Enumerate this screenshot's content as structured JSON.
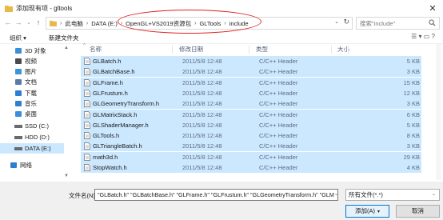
{
  "window": {
    "title": "添加现有项 - gltools",
    "close_glyph": "✕"
  },
  "nav": {
    "back": "←",
    "forward": "→",
    "up_dropdown": "⌄",
    "up": "↑"
  },
  "address": {
    "crumbs": [
      "此电脑",
      "DATA (E:)",
      "OpenGL+VS2019资源包",
      "GLTools",
      "include"
    ],
    "separator": "›",
    "dropdown_glyph": "⌄",
    "refresh_glyph": "↻"
  },
  "search": {
    "placeholder": "搜索\"include\""
  },
  "toolbar": {
    "organize": "组织 ▾",
    "new_folder": "新建文件夹",
    "view_icons": "☰ ▾  ▭  ?"
  },
  "sidebar": {
    "scroll_up": "▲",
    "scroll_down": "▼",
    "items": [
      {
        "label": "3D 对象",
        "icon": "3d-objects-icon",
        "color": "#3b8fd9"
      },
      {
        "label": "视频",
        "icon": "video-icon",
        "color": "#4a4a4a"
      },
      {
        "label": "图片",
        "icon": "pictures-icon",
        "color": "#3a95d8"
      },
      {
        "label": "文档",
        "icon": "documents-icon",
        "color": "#5b7aa8"
      },
      {
        "label": "下载",
        "icon": "downloads-icon",
        "color": "#2f7fd1"
      },
      {
        "label": "音乐",
        "icon": "music-icon",
        "color": "#2f7fd1"
      },
      {
        "label": "桌面",
        "icon": "desktop-icon",
        "color": "#3a8ddc"
      },
      {
        "label": "SSD (C:)",
        "icon": "drive-icon",
        "color": "#6a6a6a"
      },
      {
        "label": "HDD (D:)",
        "icon": "drive-icon",
        "color": "#6a6a6a"
      },
      {
        "label": "DATA (E:)",
        "icon": "drive-icon",
        "color": "#6a6a6a",
        "selected": true
      },
      {
        "label": "网络",
        "icon": "network-icon",
        "color": "#2f7fd1"
      }
    ]
  },
  "columns": {
    "name": "名称",
    "date": "修改日期",
    "type": "类型",
    "size": "大小",
    "sort_glyph": "^"
  },
  "files": [
    {
      "name": "GLBatch.h",
      "date": "2011/5/8 12:48",
      "type": "C/C++ Header",
      "size": "5 KB"
    },
    {
      "name": "GLBatchBase.h",
      "date": "2011/5/8 12:48",
      "type": "C/C++ Header",
      "size": "3 KB"
    },
    {
      "name": "GLFrame.h",
      "date": "2011/5/8 12:48",
      "type": "C/C++ Header",
      "size": "15 KB"
    },
    {
      "name": "GLFrustum.h",
      "date": "2011/5/8 12:48",
      "type": "C/C++ Header",
      "size": "12 KB"
    },
    {
      "name": "GLGeometryTransform.h",
      "date": "2011/5/8 12:48",
      "type": "C/C++ Header",
      "size": "3 KB"
    },
    {
      "name": "GLMatrixStack.h",
      "date": "2011/5/8 12:48",
      "type": "C/C++ Header",
      "size": "6 KB"
    },
    {
      "name": "GLShaderManager.h",
      "date": "2011/5/8 12:48",
      "type": "C/C++ Header",
      "size": "5 KB"
    },
    {
      "name": "GLTools.h",
      "date": "2011/5/8 12:48",
      "type": "C/C++ Header",
      "size": "8 KB"
    },
    {
      "name": "GLTriangleBatch.h",
      "date": "2011/5/8 12:48",
      "type": "C/C++ Header",
      "size": "3 KB"
    },
    {
      "name": "math3d.h",
      "date": "2011/5/8 12:48",
      "type": "C/C++ Header",
      "size": "29 KB"
    },
    {
      "name": "StopWatch.h",
      "date": "2011/5/8 12:48",
      "type": "C/C++ Header",
      "size": "4 KB"
    }
  ],
  "bottom": {
    "filename_label": "文件名(N):",
    "filename_value": "\"GLBatch.h\" \"GLBatchBase.h\" \"GLFrame.h\" \"GLFrustum.h\" \"GLGeometryTransform.h\" \"GLM",
    "filter_value": "所有文件(*.*)",
    "dropdown_glyph": "⌄",
    "add_button": "添加(A)",
    "cancel_button": "取消",
    "add_arrow": "▾"
  },
  "colors": {
    "selection": "#cce8ff",
    "highlight_ellipse": "#e02020",
    "folder": "#e8b84a"
  }
}
